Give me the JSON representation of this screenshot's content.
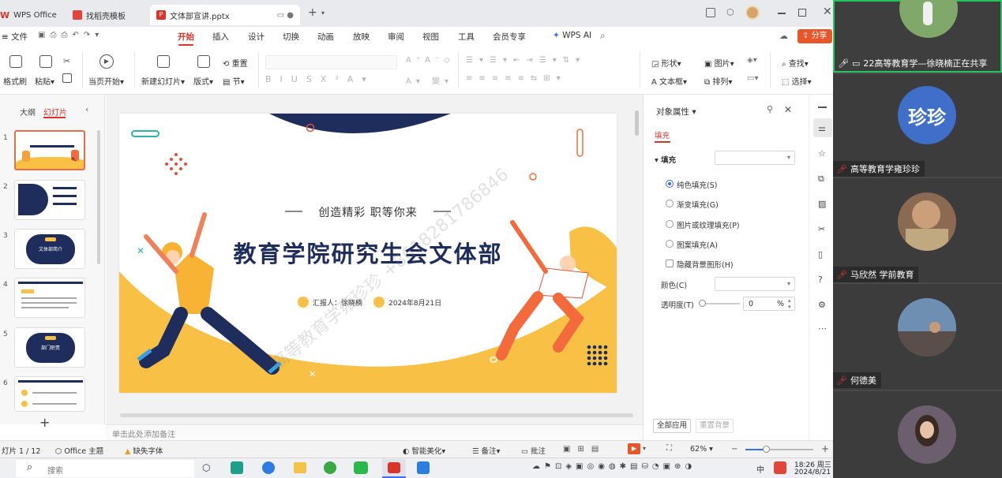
{
  "tabs": {
    "home": "WPS Office",
    "template": "找稻壳模板",
    "doc": "文体部宣讲.pptx"
  },
  "menu": {
    "file": "文件",
    "items": [
      "开始",
      "插入",
      "设计",
      "切换",
      "动画",
      "放映",
      "审阅",
      "视图",
      "工具",
      "会员专享"
    ],
    "wps_ai": "WPS AI",
    "share": "分享"
  },
  "ribbon": {
    "format_painter": "格式刷",
    "paste": "粘贴",
    "play_current": "当页开始",
    "new_slide": "新建幻灯片",
    "layout": "版式",
    "reset": "重置",
    "section": "节",
    "shape": "形状",
    "picture": "图片",
    "find": "查找",
    "textbox": "文本框",
    "arrange": "排列",
    "select": "选择"
  },
  "left_panel": {
    "outline_tab": "大纲",
    "slides_tab": "幻灯片",
    "thumb_numbers": [
      "1",
      "2",
      "3",
      "4",
      "5",
      "6"
    ],
    "thumb3_text": "文体部简介",
    "thumb5_text": "部门职责"
  },
  "slide": {
    "subtitle": "创造精彩 职等你来",
    "title": "教育学院研究生会文体部",
    "reporter": "汇报人：徐晓楠",
    "date": "2024年8月21日",
    "watermark": "高等教育学雍珍珍 +8618281786846"
  },
  "notes_placeholder": "单击此处添加备注",
  "props": {
    "title": "对象属性",
    "fill_tab": "填充",
    "fill_section": "填充",
    "options": [
      "纯色填充(S)",
      "渐变填充(G)",
      "图片或纹理填充(P)",
      "图案填充(A)"
    ],
    "hide_bg": "隐藏背景图形(H)",
    "color_label": "颜色(C)",
    "transparency_label": "透明度(T)",
    "transparency_value": "0",
    "transparency_unit": "%",
    "apply_all": "全部应用",
    "reset_bg": "重置背景"
  },
  "status": {
    "slide_counter": "灯片 1 / 12",
    "theme": "Office 主题",
    "missing_font": "缺失字体",
    "smart_beautify": "智能美化",
    "notes": "备注",
    "comments": "批注",
    "zoom": "62%"
  },
  "taskbar": {
    "search": "搜索",
    "ime": "中",
    "time": "18:26 周三",
    "date": "2024/8/21"
  },
  "meeting": {
    "sharing_label": "22高等教育学—徐晓楠正在共享",
    "p1_name": "高等教育学雍珍珍",
    "p1_avatar_text": "珍珍",
    "p2_name": "马欣然 学前教育",
    "p3_name": "何德美"
  },
  "colors": {
    "accent_red": "#d9332a",
    "slide_navy": "#1f2d5c",
    "slide_yellow": "#f8c044",
    "avatar_blue": "#3f6fc9",
    "speaking_green": "#22c55e"
  }
}
